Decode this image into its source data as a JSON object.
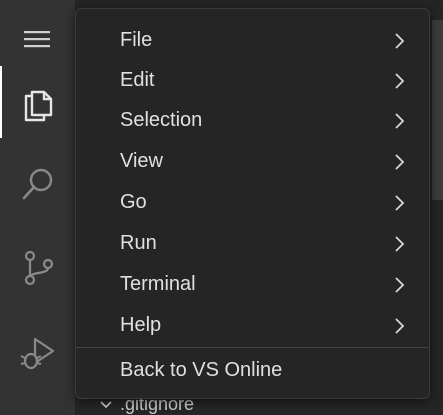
{
  "menu": {
    "items": [
      {
        "label": "File"
      },
      {
        "label": "Edit"
      },
      {
        "label": "Selection"
      },
      {
        "label": "View"
      },
      {
        "label": "Go"
      },
      {
        "label": "Run"
      },
      {
        "label": "Terminal"
      },
      {
        "label": "Help"
      }
    ],
    "back_label": "Back to VS Online"
  },
  "explorer": {
    "visible_file": ".gitignore"
  },
  "icons": {
    "menu": "hamburger-icon",
    "explorer": "files-icon",
    "search": "search-icon",
    "scm": "source-control-icon",
    "run": "run-debug-icon",
    "submenu": "chevron-right-icon"
  },
  "colors": {
    "menu_bg": "#252526",
    "activity_bar": "#333333",
    "text": "#e0e0e0"
  }
}
